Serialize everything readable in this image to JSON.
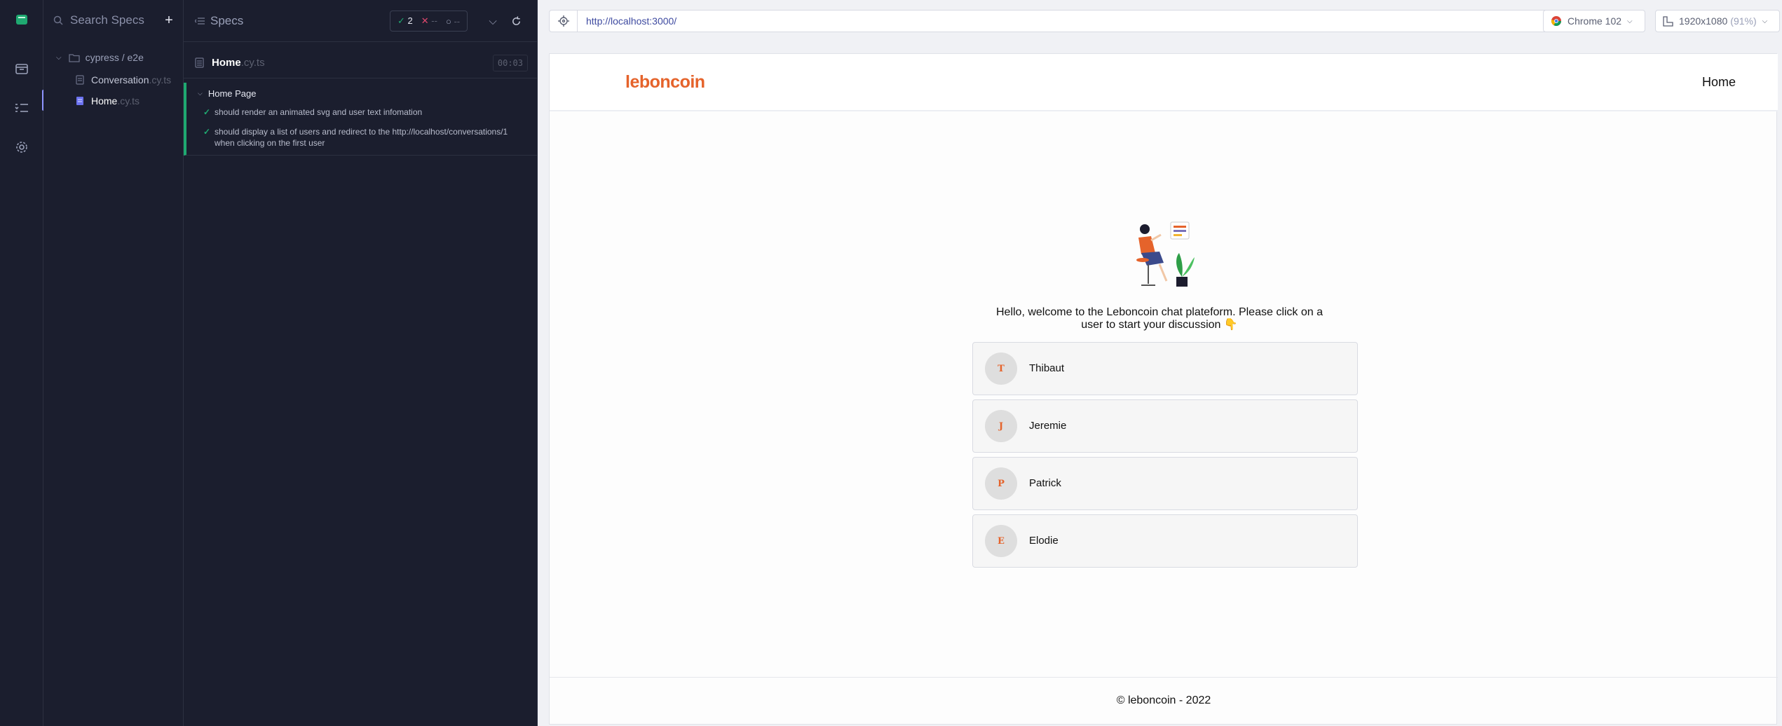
{
  "specs_panel": {
    "search_placeholder": "Search Specs",
    "add_label": "+",
    "folder": "cypress / e2e",
    "files": [
      {
        "name": "Conversation",
        "ext": ".cy.ts"
      },
      {
        "name": "Home",
        "ext": ".cy.ts"
      }
    ]
  },
  "reporter": {
    "title": "Specs",
    "passed": "2",
    "failed": "--",
    "pending": "--",
    "spec_name": "Home",
    "spec_ext": ".cy.ts",
    "duration": "00:03",
    "suite_title": "Home Page",
    "tests": [
      "should render an animated svg and user text infomation",
      "should display a list of users and redirect to the http://localhost/conversations/1 when clicking on the first user"
    ]
  },
  "browser": {
    "url": "http://localhost:3000/",
    "browser_name": "Chrome 102",
    "viewport": "1920x1080",
    "zoom": "(91%)"
  },
  "app": {
    "brand": "leboncoin",
    "nav_home": "Home",
    "welcome": "Hello, welcome to the Leboncoin chat plateform. Please click on a user to start your discussion 👇",
    "users": [
      {
        "initial": "T",
        "name": "Thibaut"
      },
      {
        "initial": "J",
        "name": "Jeremie"
      },
      {
        "initial": "P",
        "name": "Patrick"
      },
      {
        "initial": "E",
        "name": "Elodie"
      }
    ],
    "footer": "© leboncoin - 2022"
  },
  "colors": {
    "brand": "#e5632b",
    "pass": "#1fa971",
    "fail": "#e0486e",
    "accent": "#8f95ff"
  }
}
